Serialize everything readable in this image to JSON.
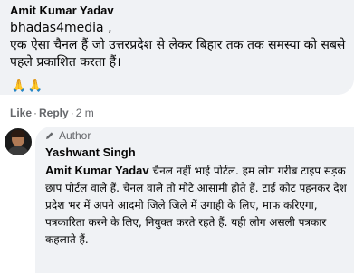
{
  "comment": {
    "author": "Amit Kumar Yadav",
    "tagline": "bhadas4media ,",
    "text": "एक ऐसा चैनल हैं जो उत्तरप्रदेश से लेकर बिहार तक तक समस्या को सबसे पहले प्रकाशित करता हैं।",
    "reaction": "🙏🙏",
    "actions": {
      "like": "Like",
      "reply": "Reply",
      "time": "2 m"
    }
  },
  "reply": {
    "badge": "Author",
    "author": "Yashwant Singh",
    "mention": "Amit Kumar Yadav",
    "text": " चैनल नहीं भाई पोर्टल. हम लोग गरीब टाइप सड़क छाप पोर्टल वाले हैं. चैनल वाले तो मोटे आसामी होते हैं. टाई कोट पहनकर देश प्रदेश भर में अपने आदमी जिले जिले में उगाही के लिए, माफ करिएगा, पत्रकारिता करने के लिए, नियुक्त करते रहते हैं. यही लोग असली पत्रकार कहलाते हैं."
  },
  "colors": {
    "bubble": "#f0f2f5",
    "secondary_text": "#65676b",
    "primary_text": "#050505"
  }
}
